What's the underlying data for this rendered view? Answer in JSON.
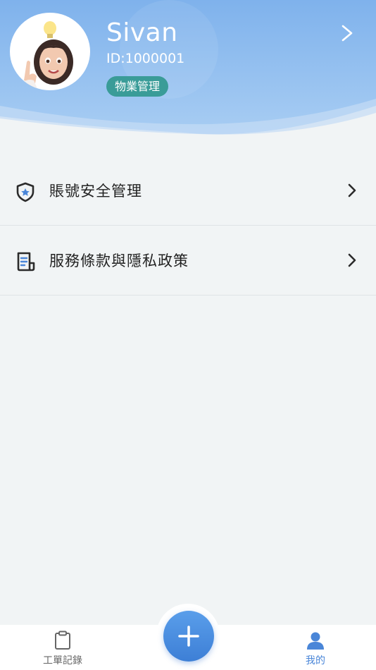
{
  "profile": {
    "name": "Sivan",
    "id_text": "ID:1000001",
    "role": "物業管理"
  },
  "menu": {
    "items": [
      {
        "label": "賬號安全管理",
        "icon": "shield-star-icon"
      },
      {
        "label": "服務條款與隱私政策",
        "icon": "document-icon"
      }
    ]
  },
  "tabbar": {
    "work_orders_label": "工單記錄",
    "mine_label": "我的",
    "add_icon": "plus-icon",
    "active_color": "#4a86d8",
    "inactive_color": "#666666"
  },
  "colors": {
    "header_top": "#84b6ee",
    "badge": "#3a9c98",
    "fab": "#4a8ae0"
  }
}
